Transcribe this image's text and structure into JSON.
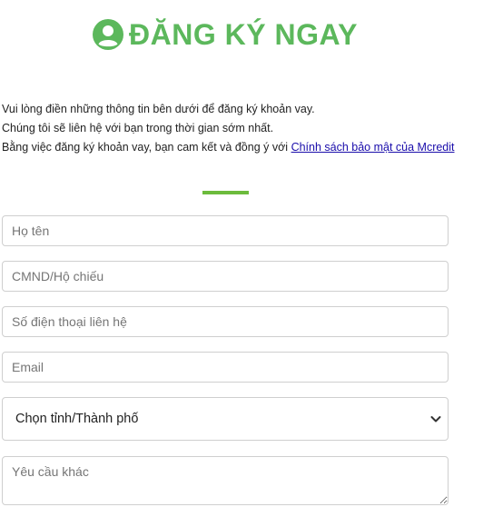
{
  "header": {
    "title": "ĐĂNG KÝ NGAY",
    "icon": "user-circle-icon",
    "accent_color": "#5cb85c"
  },
  "intro": {
    "line1": "Vui lòng điền những thông tin bên dưới để đăng ký khoản vay.",
    "line2": "Chúng tôi sẽ liên hệ với bạn trong thời gian sớm nhất.",
    "line3_prefix": "Bằng việc đăng ký khoản vay, bạn cam kết và đồng ý với ",
    "policy_link": "Chính sách bảo mật của Mcredit"
  },
  "form": {
    "name_placeholder": "Họ tên",
    "id_placeholder": "CMND/Hộ chiếu",
    "phone_placeholder": "Số điện thoại liên hệ",
    "email_placeholder": "Email",
    "city_selected": "Chọn tỉnh/Thành phố",
    "note_placeholder": "Yêu cầu khác"
  }
}
